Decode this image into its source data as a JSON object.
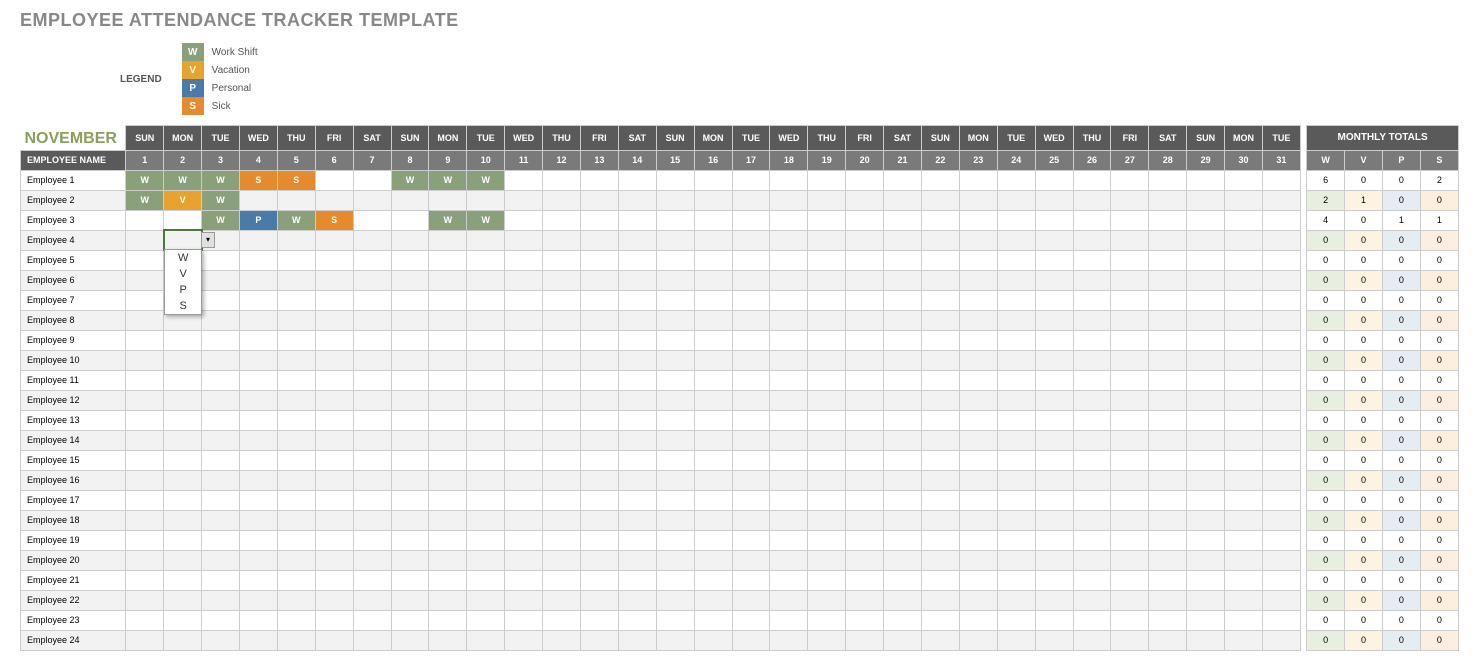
{
  "title": "EMPLOYEE ATTENDANCE TRACKER TEMPLATE",
  "legend": {
    "label": "LEGEND",
    "items": [
      {
        "code": "W",
        "text": "Work Shift"
      },
      {
        "code": "V",
        "text": "Vacation"
      },
      {
        "code": "P",
        "text": "Personal"
      },
      {
        "code": "S",
        "text": "Sick"
      }
    ]
  },
  "month": "NOVEMBER",
  "emp_header": "EMPLOYEE NAME",
  "totals_header": "MONTHLY TOTALS",
  "day_headers": [
    "SUN",
    "MON",
    "TUE",
    "WED",
    "THU",
    "FRI",
    "SAT",
    "SUN",
    "MON",
    "TUE",
    "WED",
    "THU",
    "FRI",
    "SAT",
    "SUN",
    "MON",
    "TUE",
    "WED",
    "THU",
    "FRI",
    "SAT",
    "SUN",
    "MON",
    "TUE",
    "WED",
    "THU",
    "FRI",
    "SAT",
    "SUN",
    "MON",
    "TUE"
  ],
  "day_nums": [
    "1",
    "2",
    "3",
    "4",
    "5",
    "6",
    "7",
    "8",
    "9",
    "10",
    "11",
    "12",
    "13",
    "14",
    "15",
    "16",
    "17",
    "18",
    "19",
    "20",
    "21",
    "22",
    "23",
    "24",
    "25",
    "26",
    "27",
    "28",
    "29",
    "30",
    "31"
  ],
  "totals_cols": [
    "W",
    "V",
    "P",
    "S"
  ],
  "dropdown_open": {
    "row": 3,
    "day": 1
  },
  "dropdown_opts": [
    "W",
    "V",
    "P",
    "S"
  ],
  "employees": [
    {
      "name": "Employee 1",
      "days": {
        "0": "W",
        "1": "W",
        "2": "W",
        "3": "S",
        "4": "S",
        "7": "W",
        "8": "W",
        "9": "W"
      },
      "totals": {
        "W": "6",
        "V": "0",
        "P": "0",
        "S": "2"
      }
    },
    {
      "name": "Employee 2",
      "days": {
        "0": "W",
        "1": "V",
        "2": "W"
      },
      "totals": {
        "W": "2",
        "V": "1",
        "P": "0",
        "S": "0"
      }
    },
    {
      "name": "Employee 3",
      "days": {
        "2": "W",
        "3": "P",
        "4": "W",
        "5": "S",
        "8": "W",
        "9": "W"
      },
      "totals": {
        "W": "4",
        "V": "0",
        "P": "1",
        "S": "1"
      }
    },
    {
      "name": "Employee 4",
      "days": {},
      "totals": {
        "W": "0",
        "V": "0",
        "P": "0",
        "S": "0"
      }
    },
    {
      "name": "Employee 5",
      "days": {},
      "totals": {
        "W": "0",
        "V": "0",
        "P": "0",
        "S": "0"
      }
    },
    {
      "name": "Employee 6",
      "days": {},
      "totals": {
        "W": "0",
        "V": "0",
        "P": "0",
        "S": "0"
      }
    },
    {
      "name": "Employee 7",
      "days": {},
      "totals": {
        "W": "0",
        "V": "0",
        "P": "0",
        "S": "0"
      }
    },
    {
      "name": "Employee 8",
      "days": {},
      "totals": {
        "W": "0",
        "V": "0",
        "P": "0",
        "S": "0"
      }
    },
    {
      "name": "Employee 9",
      "days": {},
      "totals": {
        "W": "0",
        "V": "0",
        "P": "0",
        "S": "0"
      }
    },
    {
      "name": "Employee 10",
      "days": {},
      "totals": {
        "W": "0",
        "V": "0",
        "P": "0",
        "S": "0"
      }
    },
    {
      "name": "Employee 11",
      "days": {},
      "totals": {
        "W": "0",
        "V": "0",
        "P": "0",
        "S": "0"
      }
    },
    {
      "name": "Employee 12",
      "days": {},
      "totals": {
        "W": "0",
        "V": "0",
        "P": "0",
        "S": "0"
      }
    },
    {
      "name": "Employee 13",
      "days": {},
      "totals": {
        "W": "0",
        "V": "0",
        "P": "0",
        "S": "0"
      }
    },
    {
      "name": "Employee 14",
      "days": {},
      "totals": {
        "W": "0",
        "V": "0",
        "P": "0",
        "S": "0"
      }
    },
    {
      "name": "Employee 15",
      "days": {},
      "totals": {
        "W": "0",
        "V": "0",
        "P": "0",
        "S": "0"
      }
    },
    {
      "name": "Employee 16",
      "days": {},
      "totals": {
        "W": "0",
        "V": "0",
        "P": "0",
        "S": "0"
      }
    },
    {
      "name": "Employee 17",
      "days": {},
      "totals": {
        "W": "0",
        "V": "0",
        "P": "0",
        "S": "0"
      }
    },
    {
      "name": "Employee 18",
      "days": {},
      "totals": {
        "W": "0",
        "V": "0",
        "P": "0",
        "S": "0"
      }
    },
    {
      "name": "Employee 19",
      "days": {},
      "totals": {
        "W": "0",
        "V": "0",
        "P": "0",
        "S": "0"
      }
    },
    {
      "name": "Employee 20",
      "days": {},
      "totals": {
        "W": "0",
        "V": "0",
        "P": "0",
        "S": "0"
      }
    },
    {
      "name": "Employee 21",
      "days": {},
      "totals": {
        "W": "0",
        "V": "0",
        "P": "0",
        "S": "0"
      }
    },
    {
      "name": "Employee 22",
      "days": {},
      "totals": {
        "W": "0",
        "V": "0",
        "P": "0",
        "S": "0"
      }
    },
    {
      "name": "Employee 23",
      "days": {},
      "totals": {
        "W": "0",
        "V": "0",
        "P": "0",
        "S": "0"
      }
    },
    {
      "name": "Employee 24",
      "days": {},
      "totals": {
        "W": "0",
        "V": "0",
        "P": "0",
        "S": "0"
      }
    }
  ]
}
